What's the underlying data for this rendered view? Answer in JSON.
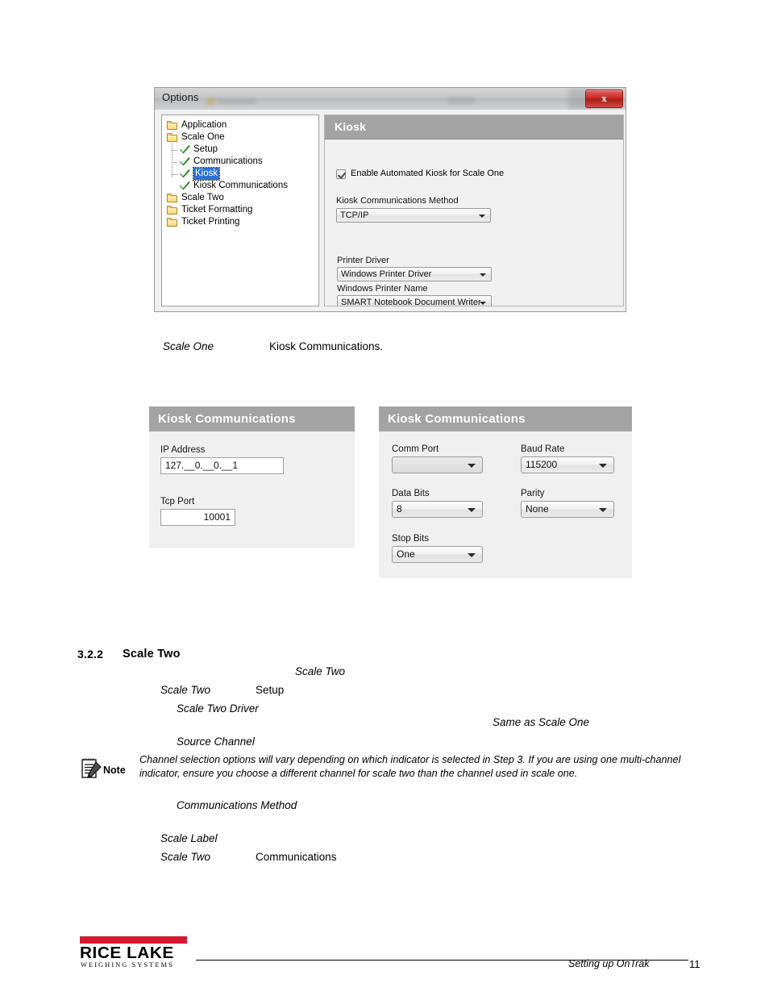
{
  "options_dialog": {
    "title": "Options",
    "close_label": "x",
    "tree": {
      "items": [
        {
          "label": "Application",
          "icon": "folder-icon",
          "level": 0,
          "selected": false
        },
        {
          "label": "Scale One",
          "icon": "folder-icon",
          "level": 0,
          "selected": false
        },
        {
          "label": "Setup",
          "icon": "green-check-icon",
          "level": 1,
          "selected": false
        },
        {
          "label": "Communications",
          "icon": "green-check-icon",
          "level": 1,
          "selected": false
        },
        {
          "label": "Kiosk",
          "icon": "green-check-icon",
          "level": 1,
          "selected": true
        },
        {
          "label": "Kiosk Communications",
          "icon": "green-check-icon",
          "level": 1,
          "selected": false
        },
        {
          "label": "Scale Two",
          "icon": "folder-icon",
          "level": 0,
          "selected": false
        },
        {
          "label": "Ticket Formatting",
          "icon": "folder-icon",
          "level": 0,
          "selected": false
        },
        {
          "label": "Ticket Printing",
          "icon": "folder-icon",
          "level": 0,
          "selected": false
        }
      ]
    },
    "content": {
      "header": "Kiosk",
      "enable_checkbox_label": "Enable Automated Kiosk for Scale One",
      "enable_checkbox_checked": true,
      "comm_method_label": "Kiosk Communications Method",
      "comm_method_value": "TCP/IP",
      "printer_driver_label": "Printer Driver",
      "printer_driver_value": "Windows Printer Driver",
      "printer_name_label": "Windows Printer Name",
      "printer_name_value": "SMART Notebook Document Writer"
    }
  },
  "caption_line": {
    "part1": "Scale  One",
    "part2": "Kiosk  Communications."
  },
  "kiosk_tcp_panel": {
    "header": "Kiosk Communications",
    "ip_label": "IP Address",
    "ip_value": "127.__0.__0.__1",
    "tcp_port_label": "Tcp Port",
    "tcp_port_value": "10001"
  },
  "kiosk_serial_panel": {
    "header": "Kiosk Communications",
    "comm_port_label": "Comm Port",
    "comm_port_value": "",
    "baud_rate_label": "Baud Rate",
    "baud_rate_value": "115200",
    "data_bits_label": "Data Bits",
    "data_bits_value": "8",
    "parity_label": "Parity",
    "parity_value": "None",
    "stop_bits_label": "Stop Bits",
    "stop_bits_value": "One"
  },
  "section": {
    "number": "3.2.2",
    "title": "Scale Two",
    "line_scale_two_a": "Scale Two",
    "line_scale_two_b": "Scale Two",
    "line_setup": "Setup",
    "line_scale_two_driver": "Scale Two Driver",
    "line_same_as_scale_one": "Same as Scale One",
    "line_source_channel": "Source Channel",
    "line_communications_method": "Communications Method",
    "line_scale_label": "Scale Label",
    "line_scale_two_c": "Scale Two",
    "line_communications": "Communications"
  },
  "note": {
    "word": "Note",
    "text": "Channel selection options will vary depending on which indicator is selected in Step 3. If you are using one multi-channel indicator, ensure you choose a different channel for scale two than the channel used in scale one."
  },
  "footer": {
    "logo_name": "RICE LAKE",
    "logo_sub": "WEIGHING SYSTEMS",
    "caption": "Setting up OnTrak",
    "page": "11",
    "logo_accent_color": "#d6192e"
  }
}
